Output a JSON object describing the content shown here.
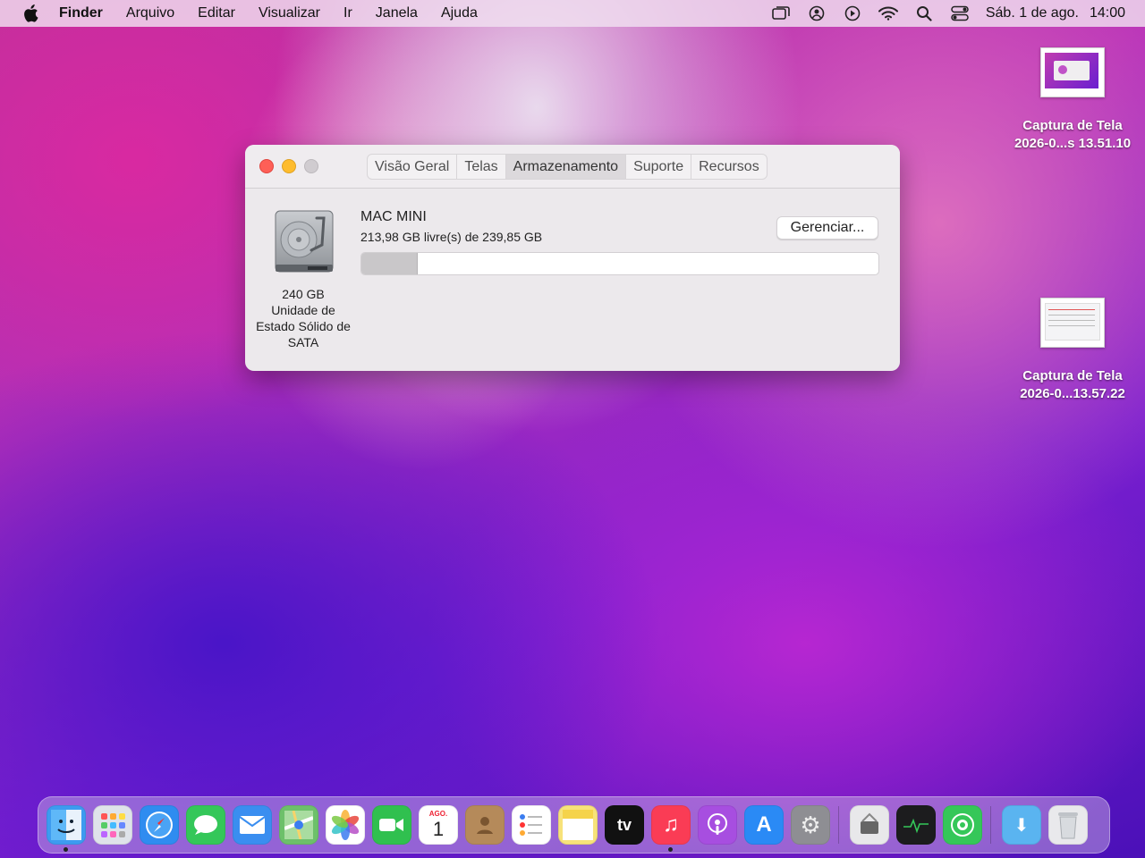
{
  "menubar": {
    "apple_icon": "apple-logo-icon",
    "app_name": "Finder",
    "menus": [
      "Arquivo",
      "Editar",
      "Visualizar",
      "Ir",
      "Janela",
      "Ajuda"
    ],
    "status_icons": [
      "screen-mirroring-icon",
      "user-account-icon",
      "play-icon",
      "wifi-icon",
      "search-icon",
      "control-center-icon"
    ],
    "date": "Sáb. 1 de ago.",
    "time": "14:00"
  },
  "window": {
    "tabs": [
      {
        "label": "Visão Geral",
        "active": false
      },
      {
        "label": "Telas",
        "active": false
      },
      {
        "label": "Armazenamento",
        "active": true
      },
      {
        "label": "Suporte",
        "active": false
      },
      {
        "label": "Recursos",
        "active": false
      }
    ],
    "drive": {
      "icon": "hard-drive-icon",
      "caption_lines": [
        "240 GB",
        "Unidade de",
        "Estado Sólido de",
        "SATA"
      ]
    },
    "volume": {
      "name": "MAC MINI",
      "free_text": "213,98 GB livre(s) de 239,85 GB",
      "used_fraction": 0.108,
      "manage_label": "Gerenciar..."
    }
  },
  "desktop": {
    "items": [
      {
        "label_line1": "Captura de Tela",
        "label_line2": "2026-0...s 13.51.10"
      },
      {
        "label_line1": "Captura de Tela",
        "label_line2": "2026-0...13.57.22"
      }
    ]
  },
  "dock": {
    "apps": [
      {
        "name": "finder",
        "icon": "finder-icon",
        "color": "#3d9bf0",
        "running": true
      },
      {
        "name": "launchpad",
        "icon": "launchpad-icon",
        "color": "#dfe3ea",
        "running": false
      },
      {
        "name": "safari",
        "icon": "safari-icon",
        "color": "#2f8cf0",
        "running": false
      },
      {
        "name": "messages",
        "icon": "messages-icon",
        "color": "#34c759",
        "running": false
      },
      {
        "name": "mail",
        "icon": "mail-icon",
        "color": "#3a8ef0",
        "running": false
      },
      {
        "name": "maps",
        "icon": "maps-icon",
        "color": "#6dc06a",
        "running": false
      },
      {
        "name": "photos",
        "icon": "photos-icon",
        "color": "#ffffff",
        "running": false
      },
      {
        "name": "facetime",
        "icon": "facetime-icon",
        "color": "#30c04f",
        "running": false
      },
      {
        "name": "calendar",
        "icon": "calendar-icon",
        "color": "#ffffff",
        "running": false,
        "month": "AGO.",
        "day": "1"
      },
      {
        "name": "contacts",
        "icon": "contacts-icon",
        "color": "#b58a5a",
        "running": false
      },
      {
        "name": "reminders",
        "icon": "reminders-icon",
        "color": "#ffffff",
        "running": false
      },
      {
        "name": "notes",
        "icon": "notes-icon",
        "color": "#f7e27a",
        "running": false
      },
      {
        "name": "apple-tv",
        "icon": "apple-tv-icon",
        "color": "#111111",
        "running": false,
        "text": "tv"
      },
      {
        "name": "music",
        "icon": "music-icon",
        "color": "#fa3c55",
        "running": true
      },
      {
        "name": "podcasts",
        "icon": "podcasts-icon",
        "color": "#a74ee0",
        "running": false
      },
      {
        "name": "app-store",
        "icon": "app-store-icon",
        "color": "#2a8af5",
        "running": false
      },
      {
        "name": "system-preferences",
        "icon": "gear-icon",
        "color": "#8e8e93",
        "running": false
      },
      {
        "name": "system-information",
        "icon": "system-information-icon",
        "color": "#e8e8ea",
        "running": false
      },
      {
        "name": "activity-monitor",
        "icon": "activity-monitor-icon",
        "color": "#1c1c1e",
        "running": false
      },
      {
        "name": "find-my",
        "icon": "find-my-icon",
        "color": "#35c759",
        "running": false
      },
      {
        "name": "downloads",
        "icon": "downloads-folder-icon",
        "color": "#5ab4f0",
        "running": false
      },
      {
        "name": "trash",
        "icon": "trash-icon",
        "color": "#e9e9ec",
        "running": false
      }
    ]
  }
}
